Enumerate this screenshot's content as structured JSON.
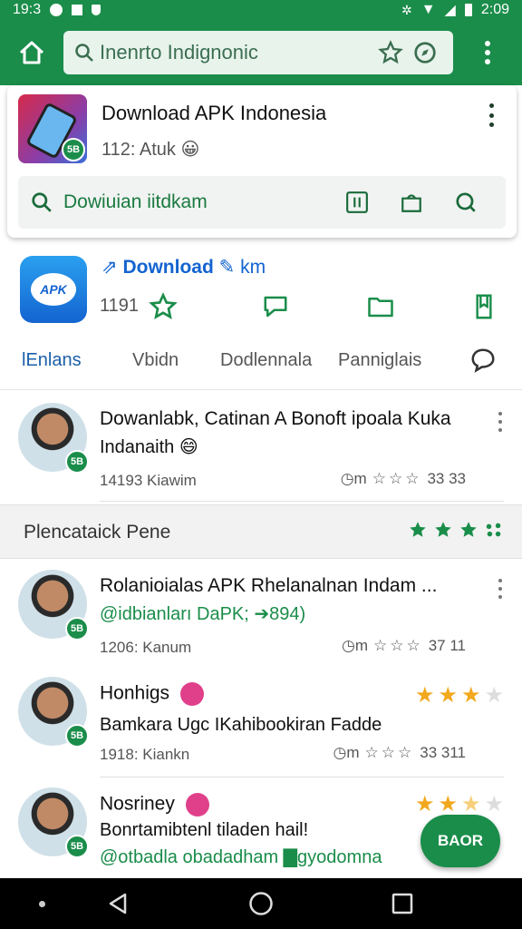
{
  "status_bar": {
    "time_left": "19:3",
    "time_right": "2:09"
  },
  "browser": {
    "url_text": "Inenrto Indignonic"
  },
  "card": {
    "title": "Download APK Indonesia",
    "subtitle": "112: Atuk 😀",
    "icon_badge": "5B",
    "search_text": "Dowiuian iitdkam"
  },
  "app": {
    "icon_text": "APK",
    "title_prefix": "Download",
    "title_suffix": "km",
    "count": "1191"
  },
  "tabs": [
    {
      "label": "lEnlans"
    },
    {
      "label": "Vbidn"
    },
    {
      "label": "Dodlennala"
    },
    {
      "label": "Panniglais"
    }
  ],
  "section": {
    "title": "Plencataick Pene"
  },
  "posts": [
    {
      "title": "Dowanlabk, Catinan A Bonoft ipoala Kuka",
      "subtitle": "Indanaith 😄",
      "meta": "14193 Kiawim",
      "stats": "33  33",
      "badge": "5B"
    },
    {
      "title": "Rolanioialas APK Rhelanalnan Indam ...",
      "subtitle": "@idbianları DaPK; ➔894)",
      "meta": "1206: Kanum",
      "stats": "37  11",
      "badge": "5B"
    },
    {
      "title": "Honhigs",
      "subtitle": "Bamkara Ugc IKahibookiran Fadde",
      "meta": "1918: Kiankn",
      "stats": "33  311",
      "badge": "5B"
    },
    {
      "title": "Nosriney",
      "subtitle": "Bonrtamibtenl tiladen hail!",
      "subtitle2": "@otbadla obadadham ▇gyodomna",
      "badge": "5B"
    }
  ],
  "fab": {
    "label": "BAOR"
  },
  "colors": {
    "brand_green": "#1a8d4a",
    "link_blue": "#1464d0",
    "star_gold": "#f2a81d"
  }
}
